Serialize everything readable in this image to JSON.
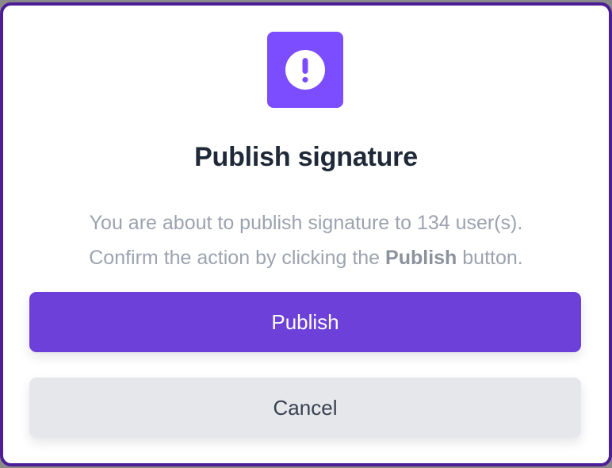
{
  "dialog": {
    "icon": "exclamation-circle-icon",
    "title": "Publish signature",
    "message_line1": "You are about to publish signature to 134 user(s).",
    "message_line2_prefix": "Confirm the action by clicking the ",
    "message_line2_bold": "Publish",
    "message_line2_suffix": " button.",
    "publish_label": "Publish",
    "cancel_label": "Cancel"
  },
  "colors": {
    "accent": "#6d40d9",
    "icon_bg": "#7c4dff",
    "title": "#1f2937",
    "muted_text": "#9ca3af",
    "cancel_bg": "#e5e7eb",
    "frame_border": "#4c1d95"
  }
}
